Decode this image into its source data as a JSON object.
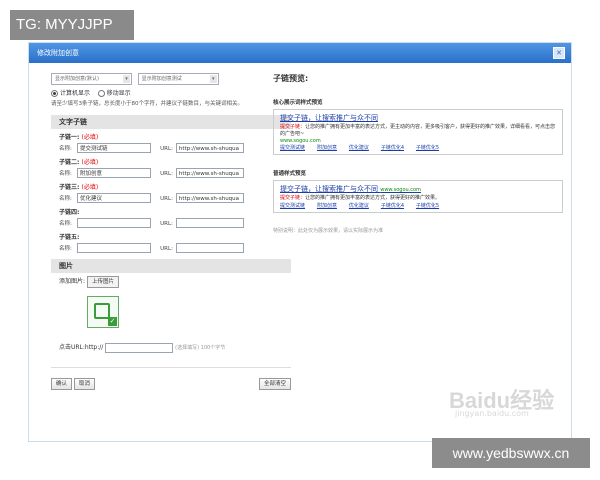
{
  "overlay": {
    "tag": "TG: MYYJJPP",
    "site": "www.yedbswwx.cn"
  },
  "dialog": {
    "title": "修改附加创意",
    "close_icon": "close-icon"
  },
  "form": {
    "select_left": "显示附加创意(默认)",
    "select_right": "显示附加创意测试",
    "radio_options": [
      {
        "label": "计算机显示",
        "checked": true
      },
      {
        "label": "移动显示",
        "checked": false
      }
    ],
    "note": "请至少填写3条子链，总长度小于80个字符，并建议子链数目，与关键词相关。",
    "text_section": "文字子链",
    "req_mark": "(必填)",
    "name_label": "名称:",
    "url_label": "URL:",
    "links": [
      {
        "header": "子链一:",
        "required": true,
        "name": "提交测试链",
        "url": "http://www.sh-shuqua"
      },
      {
        "header": "子链二:",
        "required": true,
        "name": "附加创意",
        "url": "http://www.sh-shuqua"
      },
      {
        "header": "子链三:",
        "required": true,
        "name": "优化建议",
        "url": "http://www.sh-shuqua"
      },
      {
        "header": "子链四:",
        "required": false,
        "name": "",
        "url": ""
      },
      {
        "header": "子链五:",
        "required": false,
        "name": "",
        "url": ""
      }
    ],
    "image_section": "图片",
    "add_image_label": "添加图片:",
    "upload_button": "上传图片",
    "link_url_label": "点击URL:http://",
    "link_url_hint": "(选择填写) 100个字节",
    "ok_button": "确认",
    "cancel_button": "取消",
    "clear_button": "全部清空"
  },
  "preview": {
    "title": "子链预览:",
    "sections": [
      {
        "subtitle": "核心展示词样式预览",
        "headline": "提交子链，让搜索推广与众不同",
        "desc_lead": "提交子链：",
        "desc": "让您的推广拥有更加丰富的表达方式，更主动的内容，更多吸引客户，获得更好的推广效果，详细看看，可点击您的广告吧~",
        "url": "www.sogou.com",
        "links": [
          "提交测试链",
          "附加创意",
          "优化建议",
          "子链优化4",
          "子链优化5"
        ]
      },
      {
        "subtitle": "普通样式预览",
        "headline": "提交子链，让搜索推广与众不同",
        "desc_lead": "提交子链：",
        "desc": "让您的推广拥有更加丰富的表达方式，获得更好的推广效果。",
        "url": "www.sogou.com",
        "links": [
          "提交测试链",
          "附加创意",
          "优化建议",
          "子链优化4",
          "子链优化5"
        ]
      }
    ],
    "footnote": "特别说明：此处仅为展示效果，请以实际展示为准"
  },
  "watermark": {
    "text": "Baidu经验",
    "sub": "jingyan.baidu.com"
  }
}
